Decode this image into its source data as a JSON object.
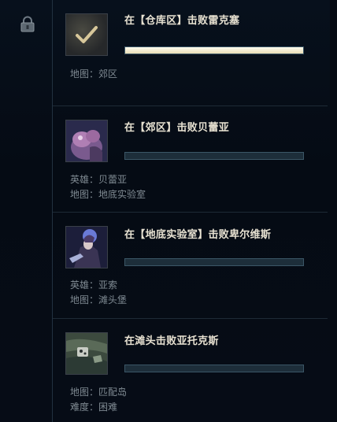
{
  "missions": [
    {
      "title": "在【仓库区】击败雷克塞",
      "progress": 1.0,
      "meta": [
        {
          "label": "地图",
          "sep": "：",
          "value": "郊区"
        }
      ]
    },
    {
      "title": "在【郊区】击败贝蕾亚",
      "progress": 0,
      "meta": [
        {
          "label": "英雄",
          "sep": "：",
          "value": "贝蕾亚"
        },
        {
          "label": "地图",
          "sep": "：",
          "value": "地底实验室"
        }
      ]
    },
    {
      "title": "在【地底实验室】击败卑尔维斯",
      "progress": 0,
      "meta": [
        {
          "label": "英雄",
          "sep": "：",
          "value": "亚索"
        },
        {
          "label": "地图",
          "sep": "：",
          "value": "滩头堡"
        }
      ]
    },
    {
      "title": "在滩头击败亚托克斯",
      "progress": 0,
      "meta": [
        {
          "label": "地图",
          "sep": "：",
          "value": "匹配岛"
        },
        {
          "label": "难度",
          "sep": "：",
          "value": "困难"
        }
      ]
    }
  ],
  "icons": {
    "rail": "lock-icon",
    "completed": "checkmark-icon"
  },
  "colors": {
    "title": "#e8e2d2",
    "meta": "#7f8a92",
    "bar_fill": "#f4eed6",
    "bar_empty": "#1d2e3a",
    "divider": "#1e2a36"
  }
}
